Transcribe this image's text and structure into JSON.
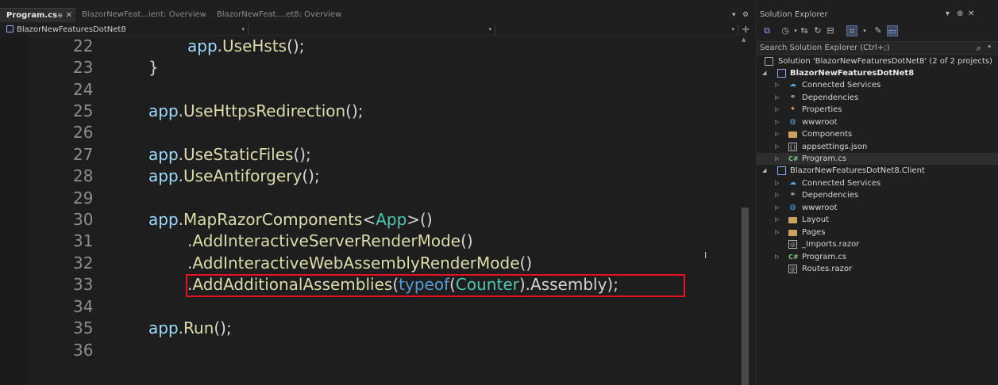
{
  "editor": {
    "tabs": [
      {
        "label": "Program.cs",
        "active": true
      },
      {
        "label": "BlazorNewFeat...ient: Overview",
        "active": false
      },
      {
        "label": "BlazorNewFeat....et8: Overview",
        "active": false
      }
    ],
    "nav": {
      "project": "BlazorNewFeaturesDotNet8",
      "type": "",
      "member": ""
    },
    "line_numbers": [
      "22",
      "23",
      "24",
      "25",
      "26",
      "27",
      "28",
      "29",
      "30",
      "31",
      "32",
      "33",
      "34",
      "35",
      "36"
    ],
    "code": {
      "l22": {
        "obj": "app",
        "dot": ".",
        "method": "UseHsts",
        "rest": "();"
      },
      "l23": {
        "text": "}"
      },
      "l25": {
        "obj": "app",
        "dot": ".",
        "method": "UseHttpsRedirection",
        "rest": "();"
      },
      "l27": {
        "obj": "app",
        "dot": ".",
        "method": "UseStaticFiles",
        "rest": "();"
      },
      "l28": {
        "obj": "app",
        "dot": ".",
        "method": "UseAntiforgery",
        "rest": "();"
      },
      "l30": {
        "obj": "app",
        "dot": ".",
        "method": "MapRazorComponents",
        "lt": "<",
        "type": "App",
        "gt": ">",
        "rest": "()"
      },
      "l31": {
        "dot": ".",
        "method": "AddInteractiveServerRenderMode",
        "rest": "()"
      },
      "l32": {
        "dot": ".",
        "method": "AddInteractiveWebAssemblyRenderMode",
        "rest": "()"
      },
      "l33": {
        "dot": ".",
        "method": "AddAdditionalAssemblies",
        "open": "(",
        "kw": "typeof",
        "open2": "(",
        "type": "Counter",
        "close2": ").",
        "prop": "Assembly",
        "rest": ");"
      },
      "l35": {
        "obj": "app",
        "dot": ".",
        "method": "Run",
        "rest": "();"
      }
    }
  },
  "solution_explorer": {
    "title": "Solution Explorer",
    "search_placeholder": "Search Solution Explorer (Ctrl+;)",
    "solution_label": "Solution 'BlazorNewFeaturesDotNet8' (2 of 2 projects)",
    "project1": {
      "name": "BlazorNewFeaturesDotNet8",
      "items": [
        "Connected Services",
        "Dependencies",
        "Properties",
        "wwwroot",
        "Components",
        "appsettings.json",
        "Program.cs"
      ]
    },
    "project2": {
      "name": "BlazorNewFeaturesDotNet8.Client",
      "items": [
        "Connected Services",
        "Dependencies",
        "wwwroot",
        "Layout",
        "Pages",
        "_Imports.razor",
        "Program.cs",
        "Routes.razor"
      ]
    },
    "icons": {
      "search": "search-icon",
      "pin": "pin-icon",
      "close": "close-icon"
    }
  },
  "colors": {
    "highlight_box": "#e81123",
    "method": "#dcdcaa",
    "variable": "#9cdcfe",
    "type": "#4ec9b0",
    "keyword": "#569cd6"
  }
}
